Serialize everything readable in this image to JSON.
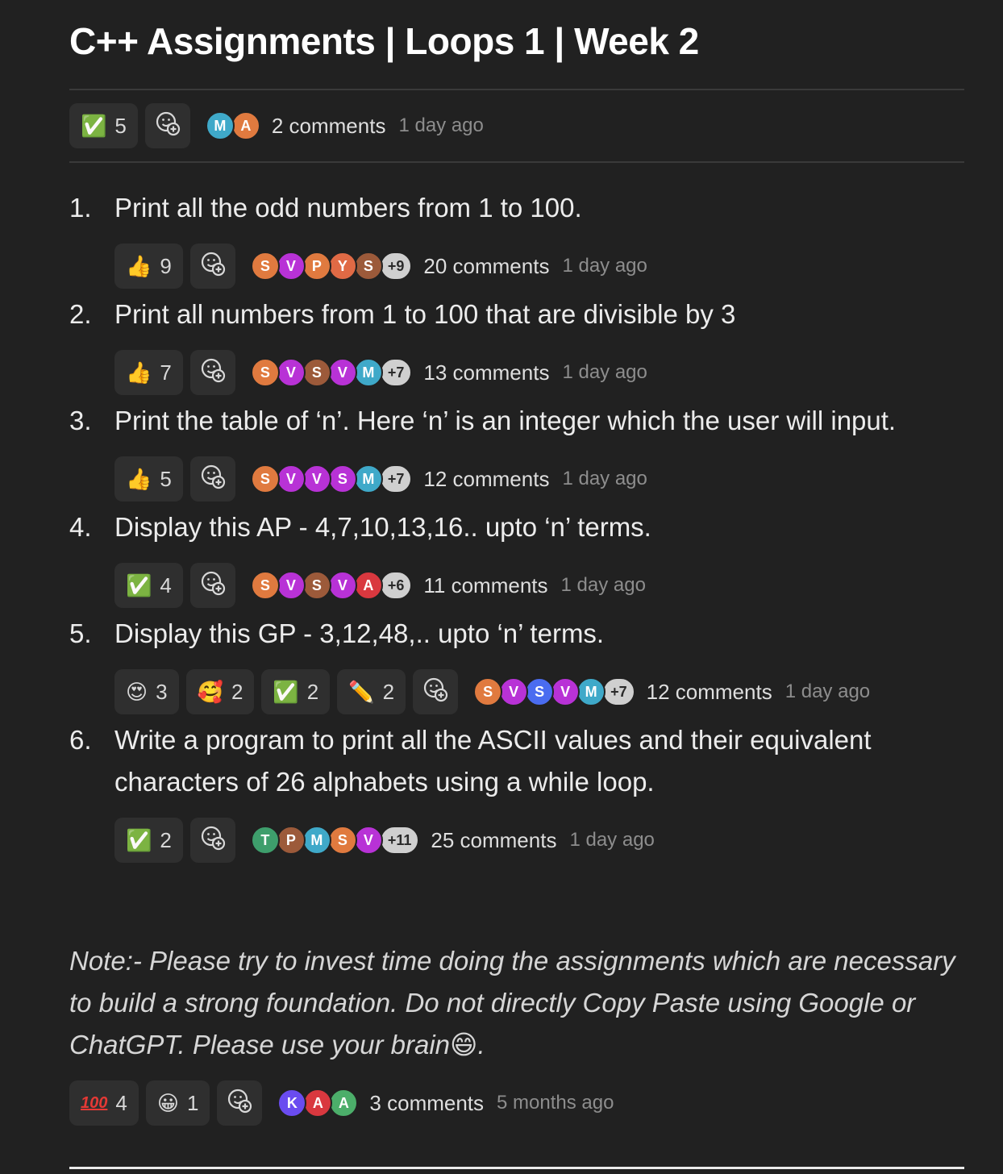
{
  "title": "C++ Assignments | Loops 1 | Week 2",
  "colors": {
    "orange": "#e07a3f",
    "purple": "#b832d6",
    "brown": "#9c5a3a",
    "cyan": "#3fa9c9",
    "red": "#d9383f",
    "teal": "#3e9e6c",
    "blue": "#4a6cf0",
    "indigo": "#6a4cf0",
    "salmon": "#e06a45",
    "green": "#4cae6a"
  },
  "header_bar": {
    "reactions": [
      {
        "emoji": "✅",
        "count": "5"
      }
    ],
    "avatars": [
      {
        "letter": "M",
        "color": "#3fa9c9"
      },
      {
        "letter": "A",
        "color": "#e07a3f"
      }
    ],
    "comments": "2 comments",
    "ago": "1 day ago"
  },
  "items": [
    {
      "num": "1.",
      "text": "Print all the odd numbers from 1 to 100.",
      "reactions": [
        {
          "emoji": "👍",
          "count": "9"
        }
      ],
      "avatars": [
        {
          "letter": "S",
          "color": "#e07a3f"
        },
        {
          "letter": "V",
          "color": "#b832d6"
        },
        {
          "letter": "P",
          "color": "#e07a3f"
        },
        {
          "letter": "Y",
          "color": "#e06a45"
        },
        {
          "letter": "S",
          "color": "#9c5a3a"
        }
      ],
      "more": "+9",
      "comments": "20 comments",
      "ago": "1 day ago"
    },
    {
      "num": "2.",
      "text": "Print all numbers from 1 to 100 that are divisible by 3",
      "reactions": [
        {
          "emoji": "👍",
          "count": "7"
        }
      ],
      "avatars": [
        {
          "letter": "S",
          "color": "#e07a3f"
        },
        {
          "letter": "V",
          "color": "#b832d6"
        },
        {
          "letter": "S",
          "color": "#9c5a3a"
        },
        {
          "letter": "V",
          "color": "#b832d6"
        },
        {
          "letter": "M",
          "color": "#3fa9c9"
        }
      ],
      "more": "+7",
      "comments": "13 comments",
      "ago": "1 day ago"
    },
    {
      "num": "3.",
      "text": "Print the table of ‘n’. Here ‘n’ is an integer which the user will input.",
      "reactions": [
        {
          "emoji": "👍",
          "count": "5"
        }
      ],
      "avatars": [
        {
          "letter": "S",
          "color": "#e07a3f"
        },
        {
          "letter": "V",
          "color": "#b832d6"
        },
        {
          "letter": "V",
          "color": "#b832d6"
        },
        {
          "letter": "S",
          "color": "#b832d6"
        },
        {
          "letter": "M",
          "color": "#3fa9c9"
        }
      ],
      "more": "+7",
      "comments": "12 comments",
      "ago": "1 day ago"
    },
    {
      "num": "4.",
      "text": "Display this AP - 4,7,10,13,16.. upto ‘n’ terms.",
      "reactions": [
        {
          "emoji": "✅",
          "count": "4"
        }
      ],
      "avatars": [
        {
          "letter": "S",
          "color": "#e07a3f"
        },
        {
          "letter": "V",
          "color": "#b832d6"
        },
        {
          "letter": "S",
          "color": "#9c5a3a"
        },
        {
          "letter": "V",
          "color": "#b832d6"
        },
        {
          "letter": "A",
          "color": "#d9383f"
        }
      ],
      "more": "+6",
      "comments": "11 comments",
      "ago": "1 day ago"
    },
    {
      "num": "5.",
      "text": "Display this GP - 3,12,48,.. upto ‘n’ terms.",
      "reactions": [
        {
          "emoji": "😍",
          "count": "3"
        },
        {
          "emoji": "🥰",
          "count": "2"
        },
        {
          "emoji": "✅",
          "count": "2"
        },
        {
          "emoji": "✏️",
          "count": "2"
        }
      ],
      "avatars": [
        {
          "letter": "S",
          "color": "#e07a3f"
        },
        {
          "letter": "V",
          "color": "#b832d6"
        },
        {
          "letter": "S",
          "color": "#4a6cf0"
        },
        {
          "letter": "V",
          "color": "#b832d6"
        },
        {
          "letter": "M",
          "color": "#3fa9c9"
        }
      ],
      "more": "+7",
      "comments": "12 comments",
      "ago": "1 day ago"
    },
    {
      "num": "6.",
      "text": "Write a program to print all the ASCII values and their equivalent characters of 26 alphabets using a while loop.",
      "reactions": [
        {
          "emoji": "✅",
          "count": "2"
        }
      ],
      "avatars": [
        {
          "letter": "T",
          "color": "#3e9e6c"
        },
        {
          "letter": "P",
          "color": "#9c5a3a"
        },
        {
          "letter": "M",
          "color": "#3fa9c9"
        },
        {
          "letter": "S",
          "color": "#e07a3f"
        },
        {
          "letter": "V",
          "color": "#b832d6"
        }
      ],
      "more": "+11",
      "comments": "25 comments",
      "ago": "1 day ago"
    }
  ],
  "note": {
    "text": "Note:- Please try to invest time doing the assignments which are necessary to build a strong foundation. Do not directly Copy Paste using Google or ChatGPT. Please use your brain😄.",
    "reactions": [
      {
        "emoji": "100",
        "count": "4"
      },
      {
        "emoji": "😀",
        "count": "1"
      }
    ],
    "avatars": [
      {
        "letter": "K",
        "color": "#6a4cf0"
      },
      {
        "letter": "A",
        "color": "#d9383f"
      },
      {
        "letter": "A",
        "color": "#4cae6a"
      }
    ],
    "comments": "3 comments",
    "ago": "5 months ago"
  }
}
